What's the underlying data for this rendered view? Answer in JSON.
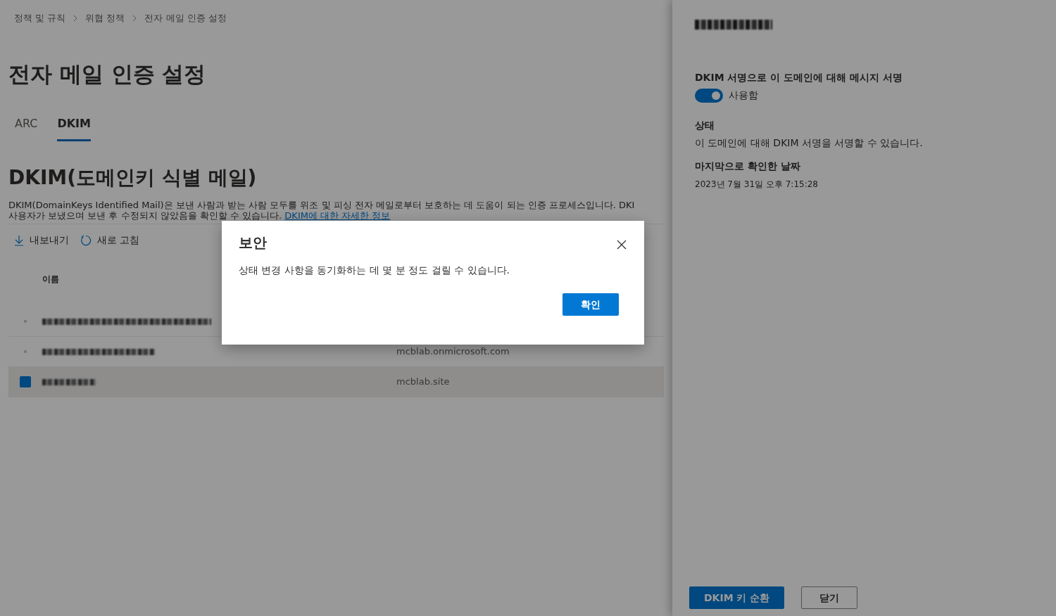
{
  "breadcrumb": [
    "정책 및 규칙",
    "위협 정책",
    "전자 메일 인증 설정"
  ],
  "page_title": "전자 메일 인증 설정",
  "tabs": [
    {
      "label": "ARC",
      "selected": false
    },
    {
      "label": "DKIM",
      "selected": true
    }
  ],
  "section_title": "DKIM(도메인키 식별 메일)",
  "description": {
    "line_1": "DKIM(DomainKeys Identified Mail)은 보낸 사람과 받는 사람 모두를 위조 및 피싱 전자 메일로부터 보호하는 데 도움이 되는 인증 프로세스입니다. DKI",
    "line_2": "사용자가 보냈으며 보낸 후 수정되지 않았음을 확인할 수 있습니다.",
    "link": "DKIM에 대한 자세한 정보"
  },
  "toolbar": [
    {
      "kind": "download",
      "label": "내보내기"
    },
    {
      "kind": "refresh",
      "label": "새로 고침"
    }
  ],
  "table": {
    "columns": [
      "이름"
    ],
    "rows": [
      {
        "selected": false
      },
      {
        "selected": false,
        "column_2": "mcblab.onmicrosoft.com"
      },
      {
        "selected": true,
        "column_2": "mcblab.site"
      }
    ]
  },
  "panel": {
    "setting_label": "DKIM 서명으로 이 도메인에 대해 메시지 서명",
    "toggle": {
      "on": true,
      "label": "사용함"
    },
    "status_heading": "상태",
    "status_text": "이 도메인에 대해 DKIM 서명을 서명할 수 있습니다.",
    "date_heading": "마지막으로 확인한 날짜",
    "date_value": "2023년 7월 31일 오후 7:15:28",
    "buttons": [
      {
        "kind": "primary",
        "label": "DKIM 키 순환"
      },
      {
        "kind": "secondary",
        "label": "닫기"
      }
    ]
  },
  "dialog": {
    "title": "보안",
    "message": "상태 변경 사항을 동기화하는 데 몇 분 정도 걸릴 수 있습니다.",
    "button": "확인"
  }
}
